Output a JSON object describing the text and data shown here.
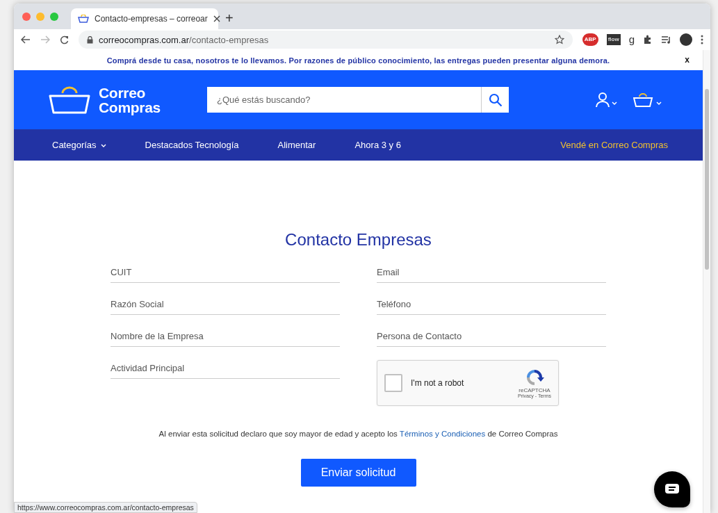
{
  "browser": {
    "tab": {
      "title": "Contacto-empresas – correoar",
      "selected": true
    },
    "new_tab": "+",
    "address": {
      "host": "correocompras.com.ar",
      "path": "/contacto-empresas"
    },
    "extensions": [
      "ABP",
      "flow",
      "g"
    ],
    "status_url": "https://www.correocompras.com.ar/contacto-empresas"
  },
  "announcement": {
    "text": "Comprá desde tu casa, nosotros te lo llevamos. Por razones de público conocimiento, las entregas pueden presentar alguna demora.",
    "close": "x"
  },
  "header": {
    "logo": [
      "Correo",
      "Compras"
    ],
    "search": {
      "placeholder": "¿Qué estás buscando?"
    }
  },
  "nav": {
    "items": [
      {
        "label": "Categorías",
        "dropdown": true
      },
      {
        "label": "Destacados Tecnología",
        "dropdown": false
      },
      {
        "label": "Alimentar",
        "dropdown": false
      },
      {
        "label": "Ahora 3 y 6",
        "dropdown": false
      }
    ],
    "seller_link": "Vendé en Correo Compras"
  },
  "form": {
    "title": "Contacto Empresas",
    "fields": [
      {
        "placeholder": "CUIT"
      },
      {
        "placeholder": "Email"
      },
      {
        "placeholder": "Razón Social"
      },
      {
        "placeholder": "Teléfono"
      },
      {
        "placeholder": "Nombre de la Empresa"
      },
      {
        "placeholder": "Persona de Contacto"
      },
      {
        "placeholder": "Actividad Principal"
      }
    ],
    "captcha": {
      "label": "I'm not a robot",
      "checked": false,
      "brand": "reCAPTCHA",
      "links": "Privacy - Terms"
    },
    "disclaimer": {
      "before": "Al enviar esta solicitud declaro que soy mayor de edad y acepto los ",
      "link": "Términos y Condiciones",
      "after": " de Correo Compras"
    },
    "submit": "Enviar solicitud"
  }
}
